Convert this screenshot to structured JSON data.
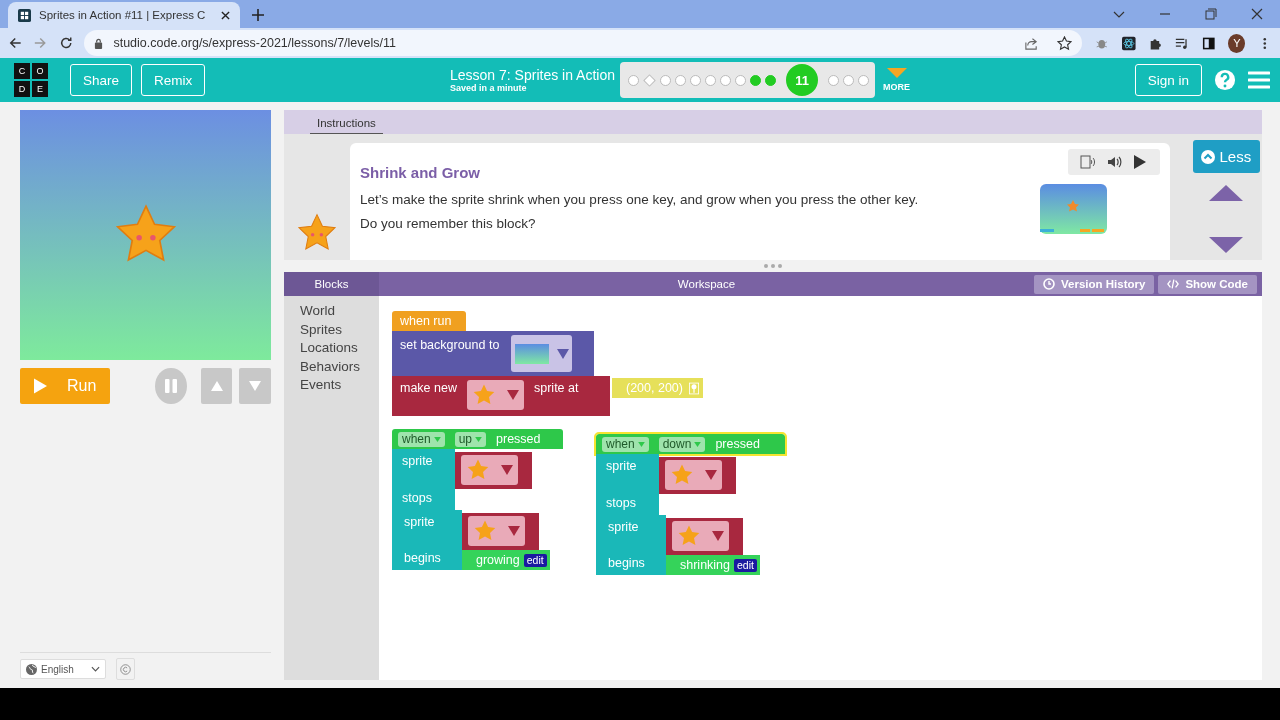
{
  "browser": {
    "tab_title": "Sprites in Action #11 | Express C",
    "url": "studio.code.org/s/express-2021/lessons/7/levels/11",
    "profile_initial": "Y"
  },
  "header": {
    "logo_letters": [
      "C",
      "O",
      "D",
      "E"
    ],
    "buttons": [
      "Share",
      "Remix"
    ],
    "lesson_title": "Lesson 7: Sprites in Action",
    "save_status": "Saved in a minute",
    "progress": [
      {
        "kind": "dot",
        "completed": false
      },
      {
        "kind": "diamond",
        "completed": false
      },
      {
        "kind": "dot",
        "completed": false
      },
      {
        "kind": "dot",
        "completed": false
      },
      {
        "kind": "dot",
        "completed": false
      },
      {
        "kind": "dot",
        "completed": false
      },
      {
        "kind": "dot",
        "completed": false
      },
      {
        "kind": "dot",
        "completed": false
      },
      {
        "kind": "dot",
        "completed": true
      },
      {
        "kind": "dot",
        "completed": true
      },
      {
        "kind": "current",
        "completed": true,
        "label": "11"
      },
      {
        "kind": "dot",
        "completed": false
      },
      {
        "kind": "dot",
        "completed": false
      },
      {
        "kind": "dot",
        "completed": false
      }
    ],
    "more_label": "MORE",
    "sign_in": "Sign in"
  },
  "stage": {
    "run_label": "Run",
    "language": "English"
  },
  "instructions": {
    "tab_label": "Instructions",
    "title": "Shrink and Grow",
    "lines": [
      "Let’s make the sprite shrink when you press one key, and grow when you press the other key.",
      "Do you remember this block?"
    ],
    "less_label": "Less"
  },
  "workspace": {
    "blocks_label": "Blocks",
    "workspace_label": "Workspace",
    "version_history": "Version History",
    "show_code": "Show Code",
    "toolbox": [
      "World",
      "Sprites",
      "Locations",
      "Behaviors",
      "Events"
    ],
    "scripts": [
      {
        "kind": "when_run",
        "label": "when run",
        "statements": [
          {
            "kind": "set_background",
            "text": "set background to"
          },
          {
            "kind": "make_sprite",
            "text_1": "make new",
            "text_2": "sprite at",
            "value": "(200, 200)"
          }
        ]
      },
      {
        "kind": "key_event",
        "highlighted": false,
        "word_1": "when",
        "key": "up",
        "word_2": "pressed",
        "statements": [
          {
            "kind": "sprite_stops",
            "text_1": "sprite",
            "text_2": "stops"
          },
          {
            "kind": "sprite_begins",
            "text_1": "sprite",
            "text_2": "begins",
            "behavior": "growing",
            "edit": "edit"
          }
        ]
      },
      {
        "kind": "key_event",
        "highlighted": true,
        "word_1": "when",
        "key": "down",
        "word_2": "pressed",
        "statements": [
          {
            "kind": "sprite_stops",
            "text_1": "sprite",
            "text_2": "stops"
          },
          {
            "kind": "sprite_begins",
            "text_1": "sprite",
            "text_2": "begins",
            "behavior": "shrinking",
            "edit": "edit"
          }
        ]
      }
    ]
  }
}
